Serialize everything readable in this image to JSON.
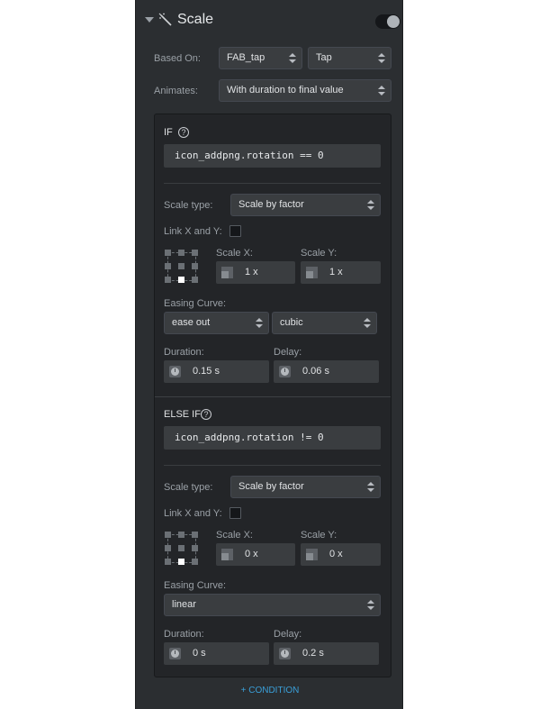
{
  "header": {
    "title": "Scale",
    "tool_icon": "wand-icon",
    "toggle_on": true
  },
  "based_on": {
    "label": "Based On:",
    "layer_value": "FAB_tap",
    "event_value": "Tap"
  },
  "animates": {
    "label": "Animates:",
    "value": "With duration to final value"
  },
  "conditions": [
    {
      "label": "IF",
      "expression": "icon_addpng.rotation == 0",
      "scale_type_label": "Scale type:",
      "scale_type": "Scale by factor",
      "link_label": "Link X and Y:",
      "scale_x_label": "Scale X:",
      "scale_x": "1 x",
      "scale_y_label": "Scale Y:",
      "scale_y": "1 x",
      "easing_label": "Easing Curve:",
      "easing": "ease out",
      "easing_type": "cubic",
      "duration_label": "Duration:",
      "duration": "0.15 s",
      "delay_label": "Delay:",
      "delay": "0.06 s"
    },
    {
      "label": "ELSE IF",
      "expression": "icon_addpng.rotation != 0",
      "scale_type_label": "Scale type:",
      "scale_type": "Scale by factor",
      "link_label": "Link X and Y:",
      "scale_x_label": "Scale X:",
      "scale_x": "0 x",
      "scale_y_label": "Scale Y:",
      "scale_y": "0 x",
      "easing_label": "Easing Curve:",
      "easing": "linear",
      "duration_label": "Duration:",
      "duration": "0 s",
      "delay_label": "Delay:",
      "delay": "0.2 s"
    }
  ],
  "add_condition": "+ CONDITION",
  "colors": {
    "panel": "#2b2e31",
    "accent": "#3a9fd8"
  }
}
